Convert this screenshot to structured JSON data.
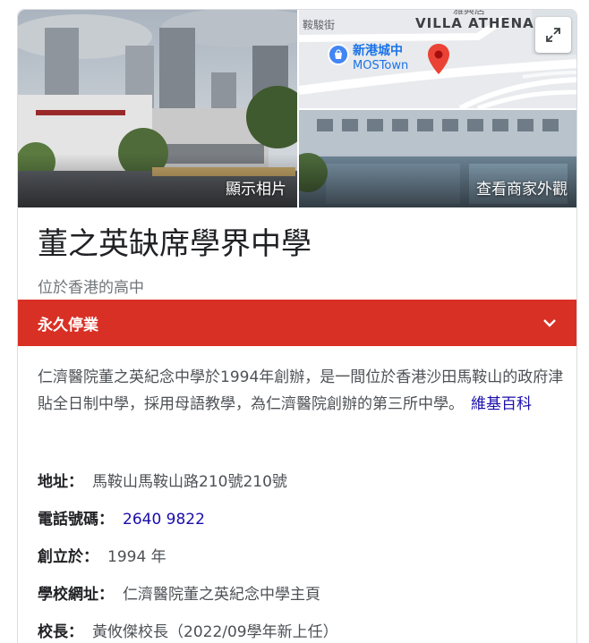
{
  "photos": {
    "main_label": "顯示相片",
    "street_label": "查看商家外觀"
  },
  "map": {
    "street_label": "鞍駿街",
    "area_label": "VILLA ATHENA",
    "area_label_top": "雅典居",
    "place_name": "新港城中",
    "place_sub": "MOSTown"
  },
  "title": "董之英缺席學界中學",
  "subtitle": "位於香港的高中",
  "status": {
    "label": "永久停業"
  },
  "description": {
    "text": "仁濟醫院董之英紀念中學於1994年創辦，是一間位於香港沙田馬鞍山的政府津貼全日制中學，採用母語教學，為仁濟醫院創辦的第三所中學。",
    "source_link": "維基百科"
  },
  "attributes": [
    {
      "label": "地址：",
      "value": "馬鞍山馬鞍山路210號210號"
    },
    {
      "label": "電話號碼：",
      "value": "2640 9822"
    },
    {
      "label": "創立於：",
      "value": "1994 年"
    },
    {
      "label": "學校網址：",
      "value": "仁濟醫院董之英紀念中學主頁"
    },
    {
      "label": "校長：",
      "value": "黃攸傑校長（2022/09學年新上任）"
    }
  ],
  "colors": {
    "closed_banner": "#d93025",
    "link": "#1a0dab",
    "map_pin": "#ea4335"
  }
}
